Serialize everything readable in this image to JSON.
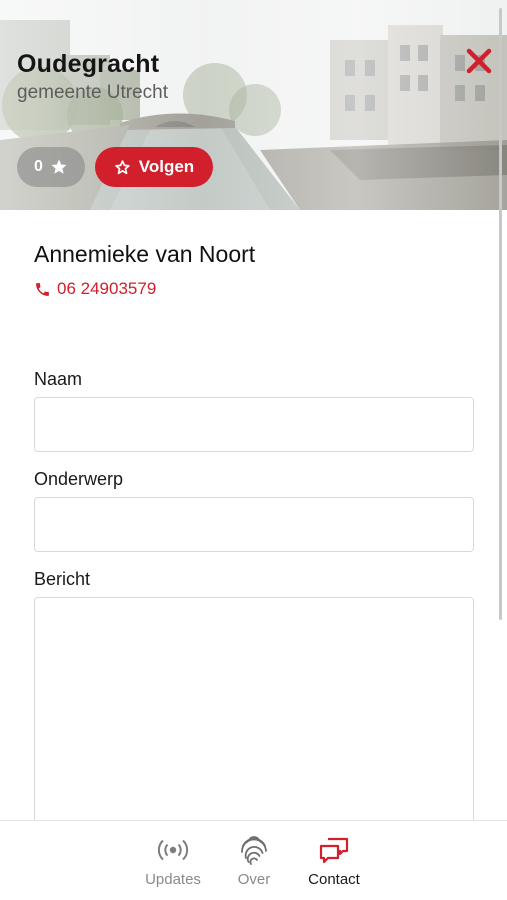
{
  "header": {
    "title": "Oudegracht",
    "subtitle": "gemeente Utrecht",
    "close_icon": "close-icon",
    "follower_count": "0",
    "follow_label": "Volgen",
    "accent_color": "#d21f2c"
  },
  "contact": {
    "name": "Annemieke van Noort",
    "phone": "06 24903579"
  },
  "form": {
    "name_label": "Naam",
    "name_value": "",
    "subject_label": "Onderwerp",
    "subject_value": "",
    "message_label": "Bericht",
    "message_value": ""
  },
  "bottom_nav": {
    "items": [
      {
        "label": "Updates",
        "icon": "broadcast-icon",
        "active": false
      },
      {
        "label": "Over",
        "icon": "fingerprint-icon",
        "active": false
      },
      {
        "label": "Contact",
        "icon": "chat-bubbles-icon",
        "active": true
      }
    ]
  }
}
